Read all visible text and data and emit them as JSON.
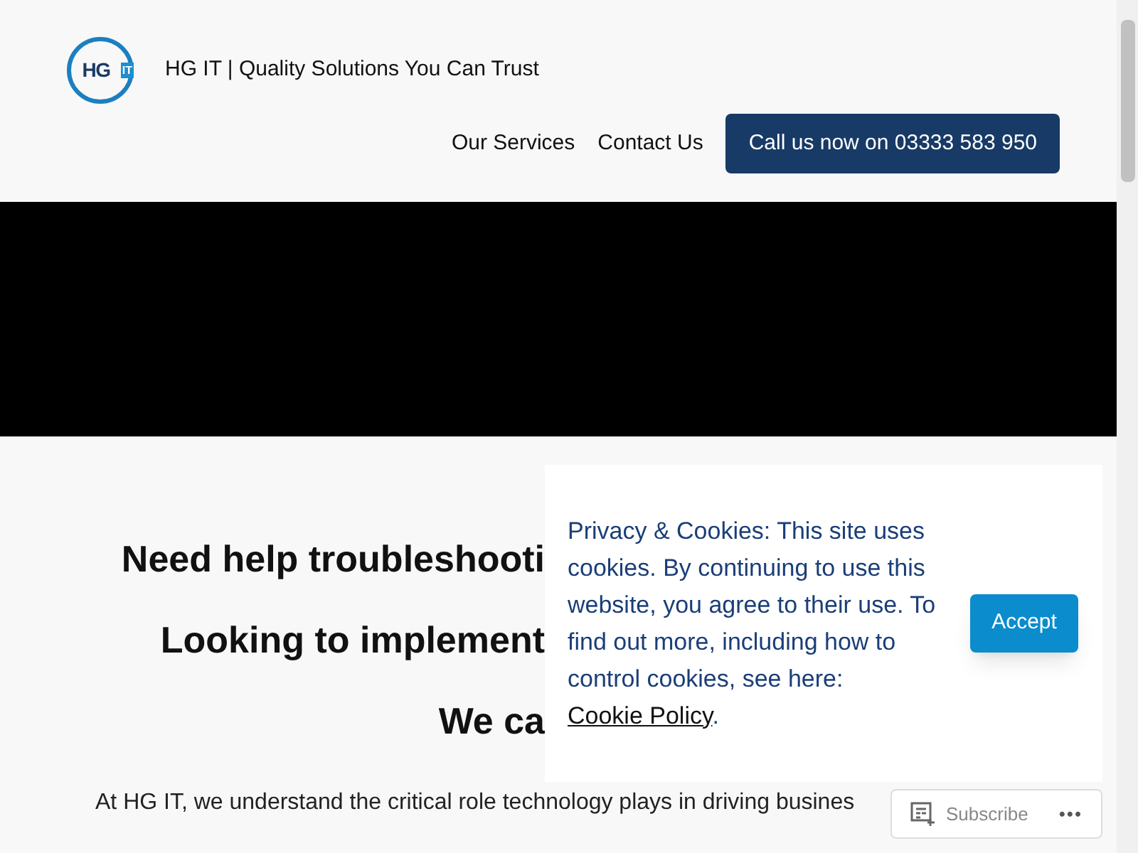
{
  "header": {
    "logo": {
      "letters": "HG",
      "badge": "IT"
    },
    "site_title": "HG IT | Quality Solutions You Can Trust",
    "nav": [
      {
        "label": "Our Services"
      },
      {
        "label": "Contact Us"
      }
    ],
    "cta_button": "Call us now on 03333 583 950"
  },
  "content": {
    "headings": [
      "Need help troubleshooti",
      "Looking to implement",
      "We ca"
    ],
    "paragraph": "At HG IT, we understand the critical role technology plays in driving busines"
  },
  "cookie_banner": {
    "text": "Privacy & Cookies: This site uses cookies. By continuing to use this website, you agree to their use. To find out more, including how to control cookies, see here: ",
    "link": "Cookie Policy",
    "after_link": ".",
    "accept_button": "Accept"
  },
  "subscribe_bar": {
    "label": "Subscribe",
    "more": "•••"
  }
}
